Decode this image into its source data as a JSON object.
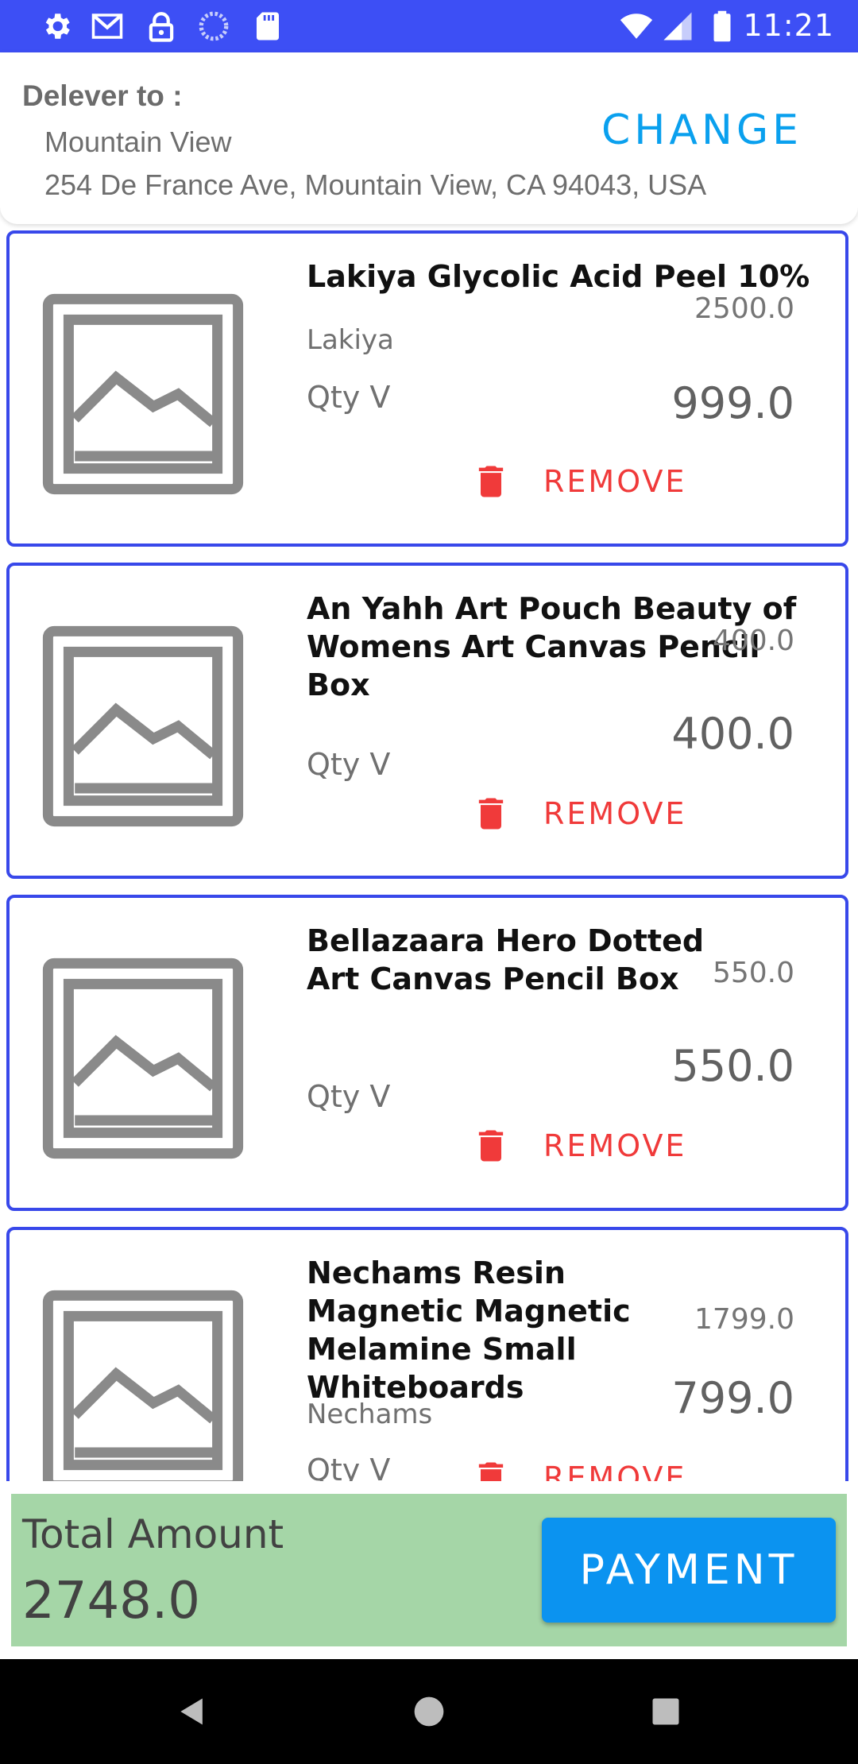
{
  "status_bar": {
    "time": "11:21",
    "icons": [
      "gear-icon",
      "gmail-icon",
      "lock-icon",
      "sync-icon",
      "sd-card-icon",
      "wifi-icon",
      "signal-icon",
      "battery-icon"
    ]
  },
  "address": {
    "label": "Delever to :",
    "city": "Mountain View",
    "full": "254 De France Ave, Mountain View, CA 94043, USA",
    "change_label": "CHANGE"
  },
  "cart": {
    "items": [
      {
        "title": "Lakiya Glycolic Acid Peel 10%",
        "brand": "Lakiya",
        "mrp": "2500.0",
        "price": "999.0",
        "qty": "Qty V",
        "remove": "REMOVE"
      },
      {
        "title": "An Yahh Art Pouch Beauty of Womens Art Canvas Pencil Box",
        "brand": "",
        "mrp": "400.0",
        "price": "400.0",
        "qty": "Qty V",
        "remove": "REMOVE"
      },
      {
        "title": "Bellazaara Hero Dotted Art Canvas Pencil Box",
        "brand": "",
        "mrp": "550.0",
        "price": "550.0",
        "qty": "Qty V",
        "remove": "REMOVE"
      },
      {
        "title": "Nechams Resin Magnetic Magnetic Melamine Small Whiteboards",
        "brand": "Nechams",
        "mrp": "1799.0",
        "price": "799.0",
        "qty": "Qty V",
        "remove": "REMOVE"
      }
    ]
  },
  "footer": {
    "total_label": "Total Amount",
    "total_value": "2748.0",
    "payment_label": "PAYMENT"
  },
  "colors": {
    "status_bar": "#3d4ff5",
    "accent_blue": "#0aa0ee",
    "card_border": "#3848ea",
    "remove_red": "#f03a3a",
    "total_bg": "#a5d6a7",
    "payment_bg": "#0b93f0"
  }
}
